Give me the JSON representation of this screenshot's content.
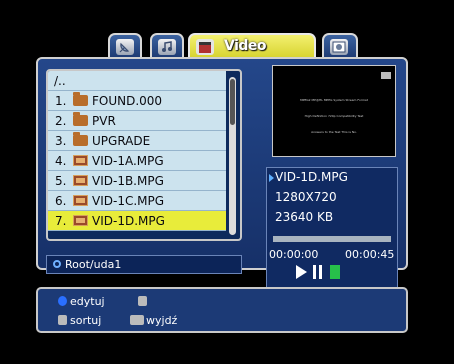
{
  "tabs": [
    {
      "icon": "satellite-dish-icon",
      "label": ""
    },
    {
      "icon": "music-note-icon",
      "label": ""
    },
    {
      "icon": "film-clapper-icon",
      "label": "Video"
    },
    {
      "icon": "picture-icon",
      "label": ""
    }
  ],
  "files": [
    {
      "num": "",
      "name": "/..",
      "type": "up"
    },
    {
      "num": "1.",
      "name": "FOUND.000",
      "type": "folder"
    },
    {
      "num": "2.",
      "name": "PVR",
      "type": "folder"
    },
    {
      "num": "3.",
      "name": "UPGRADE",
      "type": "folder"
    },
    {
      "num": "4.",
      "name": "VID-1A.MPG",
      "type": "video"
    },
    {
      "num": "5.",
      "name": "VID-1B.MPG",
      "type": "video"
    },
    {
      "num": "6.",
      "name": "VID-1C.MPG",
      "type": "video"
    },
    {
      "num": "7.",
      "name": "VID-1D.MPG",
      "type": "video",
      "selected": true
    }
  ],
  "path": "Root/uda1",
  "info": {
    "filename": "VID-1D.MPG",
    "resolution": "1280X720",
    "size": "23640 KB",
    "time_elapsed": "00:00:00",
    "time_total": "00:00:45",
    "progress": 0
  },
  "preview_lines": [
    "MPEG2 MP@HL   MPEG System Stream Format",
    "High Definition 720p Compatibility Test",
    "Answers to the Test   This is No."
  ],
  "hints": {
    "edit": "edytuj",
    "sort": "sortuj",
    "exit": "wyjdź"
  },
  "colors": {
    "panel_blue": "#1c3870",
    "list_row": "#cce3ee",
    "selected_row": "#e8ec3a",
    "active_tab": "#e8e43a",
    "hint_blue": "#2a6fff",
    "hint_green": "#27c04a"
  }
}
